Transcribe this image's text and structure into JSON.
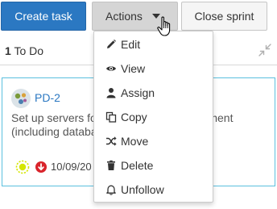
{
  "toolbar": {
    "create_label": "Create task",
    "actions_label": "Actions",
    "close_label": "Close sprint"
  },
  "column": {
    "count": "1",
    "name": "To Do"
  },
  "card": {
    "key": "PD-2",
    "title_line1": "Set up servers for development environment",
    "title_line2": "(including databases)",
    "date": "10/09/20"
  },
  "menu": {
    "items": [
      {
        "label": "Edit",
        "icon": "pencil-icon"
      },
      {
        "label": "View",
        "icon": "eye-icon"
      },
      {
        "label": "Assign",
        "icon": "user-icon"
      },
      {
        "label": "Copy",
        "icon": "copy-icon"
      },
      {
        "label": "Move",
        "icon": "shuffle-icon"
      },
      {
        "label": "Delete",
        "icon": "trash-icon"
      },
      {
        "label": "Unfollow",
        "icon": "bell-icon"
      }
    ]
  },
  "colors": {
    "primary": "#2b78c2",
    "card_border": "#5bc0de",
    "priority": "#d9242b",
    "status": "#d4e600"
  }
}
